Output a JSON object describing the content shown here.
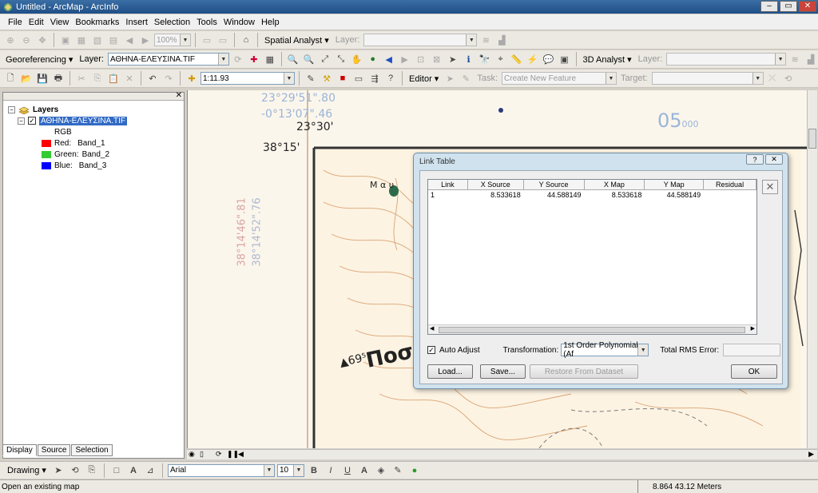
{
  "window": {
    "title": "Untitled - ArcMap - ArcInfo"
  },
  "menu": [
    "File",
    "Edit",
    "View",
    "Bookmarks",
    "Insert",
    "Selection",
    "Tools",
    "Window",
    "Help"
  ],
  "toolbar1": {
    "zoom_value": "100%",
    "spatial_analyst": "Spatial Analyst ▾",
    "layer_label": "Layer:"
  },
  "georef": {
    "label": "Georeferencing ▾",
    "layer_label": "Layer:",
    "layer_value": "ΑΘΗΝΑ-ΕΛΕΥΣΙΝΑ.TIF",
    "analyst3d": "3D Analyst ▾",
    "layer2_label": "Layer:"
  },
  "standard": {
    "scale": "1:11.93",
    "editor": "Editor ▾",
    "task_label": "Task:",
    "task_value": "Create New Feature",
    "target_label": "Target:"
  },
  "toc": {
    "root": "Layers",
    "layer": "ΑΘΗΝΑ-ΕΛΕΥΣΙΝΑ.TIF",
    "rgb": "RGB",
    "bands": [
      {
        "label": "Red:",
        "band": "Band_1",
        "color": "#ff0000"
      },
      {
        "label": "Green:",
        "band": "Band_2",
        "color": "#33cc33"
      },
      {
        "label": "Blue:",
        "band": "Band_3",
        "color": "#0000ff"
      }
    ],
    "tabs": [
      "Display",
      "Source",
      "Selection"
    ]
  },
  "map_labels": {
    "lon": "23°29'51\".80",
    "lon2": "-0°13'07\".46",
    "lon3": "23°30'",
    "lat": "38°15'",
    "grid": "05",
    "grid_sub": "000",
    "lat_rot1": "38°14'46\".81",
    "lat_rot2": "38°14'52\".76",
    "place": "Ποσ",
    "elev": "▲69⁵",
    "small": "Μ α υ"
  },
  "link_table": {
    "title": "Link Table",
    "columns": [
      "Link",
      "X Source",
      "Y Source",
      "X Map",
      "Y Map",
      "Residual"
    ],
    "rows": [
      {
        "link": "1",
        "xs": "8.533618",
        "ys": "44.588149",
        "xm": "8.533618",
        "ym": "44.588149",
        "res": ""
      }
    ],
    "auto_adjust": "Auto Adjust",
    "transformation_label": "Transformation:",
    "transformation_value": "1st Order Polynomial (Af",
    "rms_label": "Total RMS Error:",
    "rms_value": "",
    "load": "Load...",
    "save": "Save...",
    "restore": "Restore From Dataset",
    "ok": "OK"
  },
  "drawing": {
    "label": "Drawing ▾",
    "font": "Arial",
    "size": "10"
  },
  "status": {
    "message": "Open an existing map",
    "coords": "8.864  43.12 Meters"
  }
}
